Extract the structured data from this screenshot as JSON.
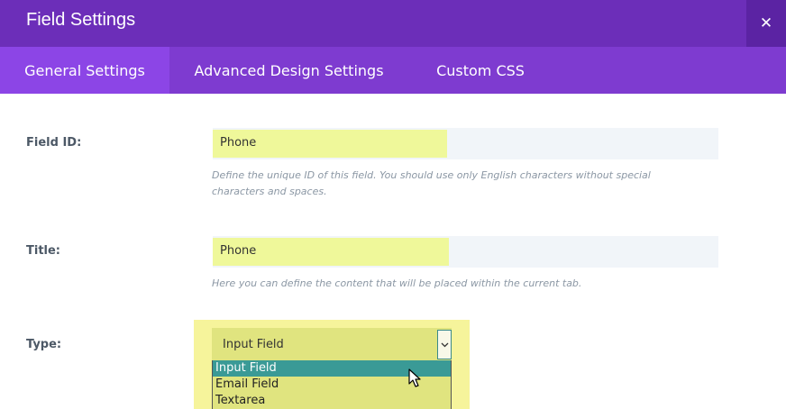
{
  "modal": {
    "title": "Field Settings",
    "close_icon": "close-icon",
    "header_color": "#6c2eb9"
  },
  "tabs": [
    {
      "label": "General Settings",
      "active": true
    },
    {
      "label": "Advanced Design Settings",
      "active": false
    },
    {
      "label": "Custom CSS",
      "active": false
    }
  ],
  "fields": {
    "field_id": {
      "label": "Field ID:",
      "value": "Phone",
      "help": "Define the unique ID of this field. You should use only English characters without special characters and spaces."
    },
    "title": {
      "label": "Title:",
      "value": "Phone",
      "help": "Here you can define the content that will be placed within the current tab."
    },
    "type": {
      "label": "Type:",
      "value": "Input Field",
      "options": [
        "Input Field",
        "Email Field",
        "Textarea"
      ],
      "highlighted_option": "Input Field"
    }
  }
}
